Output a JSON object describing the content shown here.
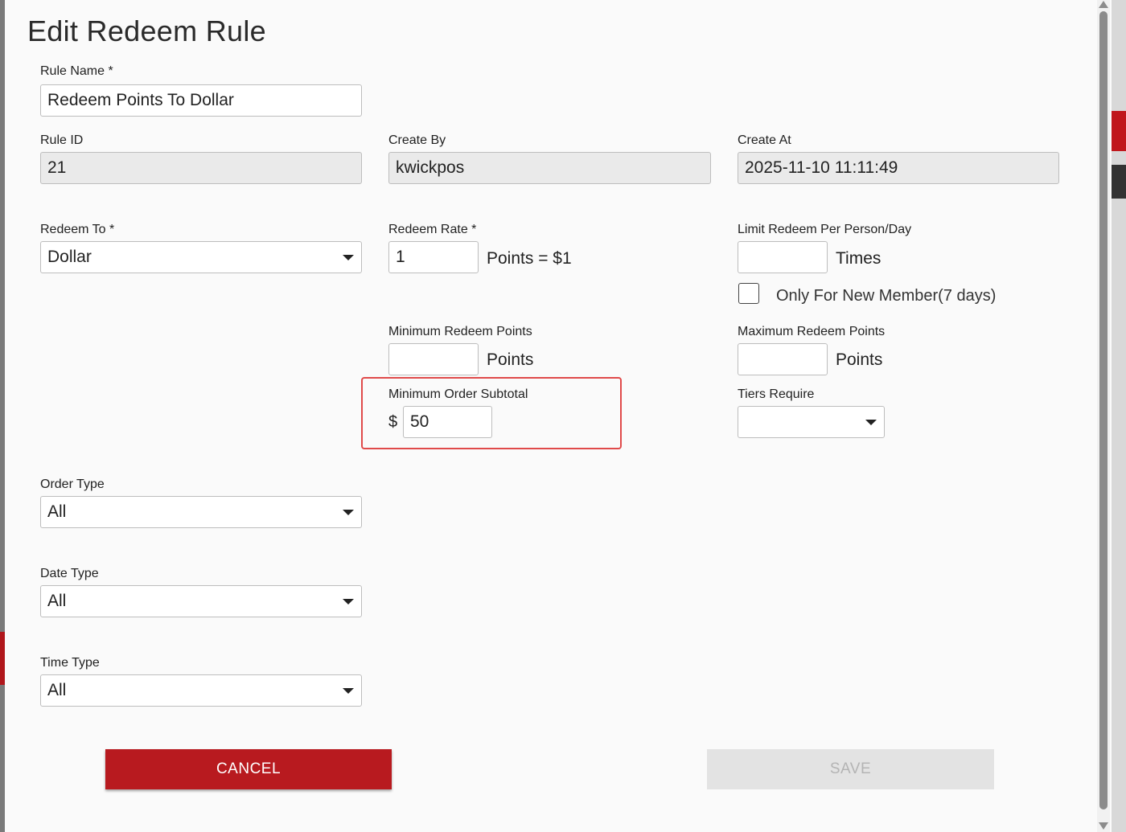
{
  "dialog": {
    "title": "Edit Redeem Rule"
  },
  "fields": {
    "rule_name": {
      "label": "Rule Name *",
      "value": "Redeem Points To Dollar"
    },
    "rule_id": {
      "label": "Rule ID",
      "value": "21"
    },
    "create_by": {
      "label": "Create By",
      "value": "kwickpos"
    },
    "create_at": {
      "label": "Create At",
      "value": "2025-11-10 11:11:49"
    },
    "redeem_to": {
      "label": "Redeem To *",
      "value": "Dollar"
    },
    "redeem_rate": {
      "label": "Redeem Rate *",
      "value": "1",
      "suffix": "Points = $1"
    },
    "limit_redeem": {
      "label": "Limit Redeem Per Person/Day",
      "value": "",
      "suffix": "Times"
    },
    "new_member_only": {
      "label": "Only For New Member(7 days)",
      "checked": false
    },
    "min_redeem_points": {
      "label": "Minimum Redeem Points",
      "value": "",
      "suffix": "Points"
    },
    "max_redeem_points": {
      "label": "Maximum Redeem Points",
      "value": "",
      "suffix": "Points"
    },
    "min_order_subtotal": {
      "label": "Minimum Order Subtotal",
      "prefix": "$",
      "value": "50"
    },
    "tiers_require": {
      "label": "Tiers Require",
      "value": ""
    },
    "order_type": {
      "label": "Order Type",
      "value": "All"
    },
    "date_type": {
      "label": "Date Type",
      "value": "All"
    },
    "time_type": {
      "label": "Time Type",
      "value": "All"
    }
  },
  "buttons": {
    "cancel": "CANCEL",
    "save": "SAVE"
  },
  "colors": {
    "primary_red": "#b81a1f",
    "highlight_border": "#e04a4a",
    "disabled_bg": "#e3e3e3"
  }
}
